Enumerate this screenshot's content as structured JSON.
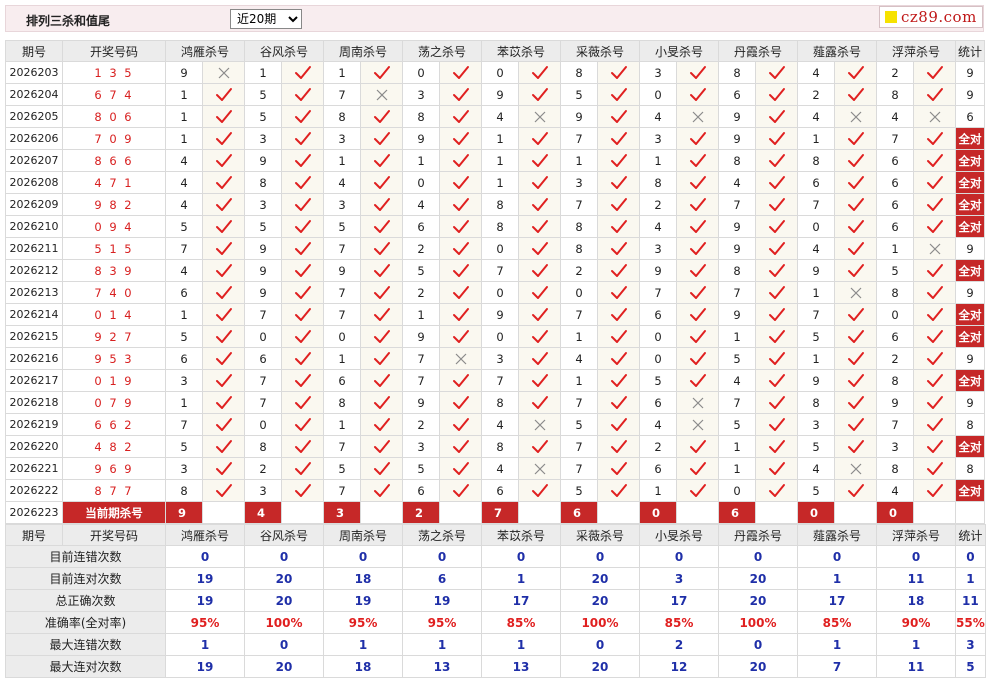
{
  "header": {
    "title": "排列三杀和值尾",
    "period_select": "近20期",
    "logo_text": "cz89.com"
  },
  "columns": {
    "period": "期号",
    "numbers": "开奖号码",
    "killers": [
      "鸿雁杀号",
      "谷风杀号",
      "周南杀号",
      "荡之杀号",
      "苯苡杀号",
      "采薇杀号",
      "小旻杀号",
      "丹霞杀号",
      "薤露杀号",
      "浮萍杀号"
    ],
    "total": "统计"
  },
  "full_label": "全对",
  "rows": [
    {
      "period": "2026203",
      "numbers": "1 3 5",
      "kills": [
        9,
        1,
        1,
        0,
        0,
        8,
        3,
        8,
        4,
        2
      ],
      "marks": [
        "x",
        "v",
        "v",
        "v",
        "v",
        "v",
        "v",
        "v",
        "v",
        "v"
      ],
      "total": "9"
    },
    {
      "period": "2026204",
      "numbers": "6 7 4",
      "kills": [
        1,
        5,
        7,
        3,
        9,
        5,
        0,
        6,
        2,
        8
      ],
      "marks": [
        "v",
        "v",
        "x",
        "v",
        "v",
        "v",
        "v",
        "v",
        "v",
        "v"
      ],
      "total": "9"
    },
    {
      "period": "2026205",
      "numbers": "8 0 6",
      "kills": [
        1,
        5,
        8,
        8,
        4,
        9,
        4,
        9,
        4,
        4
      ],
      "marks": [
        "v",
        "v",
        "v",
        "v",
        "x",
        "v",
        "x",
        "v",
        "x",
        "x"
      ],
      "total": "6"
    },
    {
      "period": "2026206",
      "numbers": "7 0 9",
      "kills": [
        1,
        3,
        3,
        9,
        1,
        7,
        3,
        9,
        1,
        7
      ],
      "marks": [
        "v",
        "v",
        "v",
        "v",
        "v",
        "v",
        "v",
        "v",
        "v",
        "v"
      ],
      "total": "全对"
    },
    {
      "period": "2026207",
      "numbers": "8 6 6",
      "kills": [
        4,
        9,
        1,
        1,
        1,
        1,
        1,
        8,
        8,
        6
      ],
      "marks": [
        "v",
        "v",
        "v",
        "v",
        "v",
        "v",
        "v",
        "v",
        "v",
        "v"
      ],
      "total": "全对"
    },
    {
      "period": "2026208",
      "numbers": "4 7 1",
      "kills": [
        4,
        8,
        4,
        0,
        1,
        3,
        8,
        4,
        6,
        6
      ],
      "marks": [
        "v",
        "v",
        "v",
        "v",
        "v",
        "v",
        "v",
        "v",
        "v",
        "v"
      ],
      "total": "全对"
    },
    {
      "period": "2026209",
      "numbers": "9 8 2",
      "kills": [
        4,
        3,
        3,
        4,
        8,
        7,
        2,
        7,
        7,
        6
      ],
      "marks": [
        "v",
        "v",
        "v",
        "v",
        "v",
        "v",
        "v",
        "v",
        "v",
        "v"
      ],
      "total": "全对"
    },
    {
      "period": "2026210",
      "numbers": "0 9 4",
      "kills": [
        5,
        5,
        5,
        6,
        8,
        8,
        4,
        9,
        0,
        6
      ],
      "marks": [
        "v",
        "v",
        "v",
        "v",
        "v",
        "v",
        "v",
        "v",
        "v",
        "v"
      ],
      "total": "全对"
    },
    {
      "period": "2026211",
      "numbers": "5 1 5",
      "kills": [
        7,
        9,
        7,
        2,
        0,
        8,
        3,
        9,
        4,
        1
      ],
      "marks": [
        "v",
        "v",
        "v",
        "v",
        "v",
        "v",
        "v",
        "v",
        "v",
        "x"
      ],
      "total": "9"
    },
    {
      "period": "2026212",
      "numbers": "8 3 9",
      "kills": [
        4,
        9,
        9,
        5,
        7,
        2,
        9,
        8,
        9,
        5
      ],
      "marks": [
        "v",
        "v",
        "v",
        "v",
        "v",
        "v",
        "v",
        "v",
        "v",
        "v"
      ],
      "total": "全对"
    },
    {
      "period": "2026213",
      "numbers": "7 4 0",
      "kills": [
        6,
        9,
        7,
        2,
        0,
        0,
        7,
        7,
        1,
        8
      ],
      "marks": [
        "v",
        "v",
        "v",
        "v",
        "v",
        "v",
        "v",
        "v",
        "x",
        "v"
      ],
      "total": "9"
    },
    {
      "period": "2026214",
      "numbers": "0 1 4",
      "kills": [
        1,
        7,
        7,
        1,
        9,
        7,
        6,
        9,
        7,
        0
      ],
      "marks": [
        "v",
        "v",
        "v",
        "v",
        "v",
        "v",
        "v",
        "v",
        "v",
        "v"
      ],
      "total": "全对"
    },
    {
      "period": "2026215",
      "numbers": "9 2 7",
      "kills": [
        5,
        0,
        0,
        9,
        0,
        1,
        0,
        1,
        5,
        6
      ],
      "marks": [
        "v",
        "v",
        "v",
        "v",
        "v",
        "v",
        "v",
        "v",
        "v",
        "v"
      ],
      "total": "全对"
    },
    {
      "period": "2026216",
      "numbers": "9 5 3",
      "kills": [
        6,
        6,
        1,
        7,
        3,
        4,
        0,
        5,
        1,
        2
      ],
      "marks": [
        "v",
        "v",
        "v",
        "x",
        "v",
        "v",
        "v",
        "v",
        "v",
        "v"
      ],
      "total": "9"
    },
    {
      "period": "2026217",
      "numbers": "0 1 9",
      "kills": [
        3,
        7,
        6,
        7,
        7,
        1,
        5,
        4,
        9,
        8
      ],
      "marks": [
        "v",
        "v",
        "v",
        "v",
        "v",
        "v",
        "v",
        "v",
        "v",
        "v"
      ],
      "total": "全对"
    },
    {
      "period": "2026218",
      "numbers": "0 7 9",
      "kills": [
        1,
        7,
        8,
        9,
        8,
        7,
        6,
        7,
        8,
        9
      ],
      "marks": [
        "v",
        "v",
        "v",
        "v",
        "v",
        "v",
        "x",
        "v",
        "v",
        "v"
      ],
      "total": "9"
    },
    {
      "period": "2026219",
      "numbers": "6 6 2",
      "kills": [
        7,
        0,
        1,
        2,
        4,
        5,
        4,
        5,
        3,
        7
      ],
      "marks": [
        "v",
        "v",
        "v",
        "v",
        "x",
        "v",
        "x",
        "v",
        "v",
        "v"
      ],
      "total": "8"
    },
    {
      "period": "2026220",
      "numbers": "4 8 2",
      "kills": [
        5,
        8,
        7,
        3,
        8,
        7,
        2,
        1,
        5,
        3
      ],
      "marks": [
        "v",
        "v",
        "v",
        "v",
        "v",
        "v",
        "v",
        "v",
        "v",
        "v"
      ],
      "total": "全对"
    },
    {
      "period": "2026221",
      "numbers": "9 6 9",
      "kills": [
        3,
        2,
        5,
        5,
        4,
        7,
        6,
        1,
        4,
        8
      ],
      "marks": [
        "v",
        "v",
        "v",
        "v",
        "x",
        "v",
        "v",
        "v",
        "x",
        "v"
      ],
      "total": "8"
    },
    {
      "period": "2026222",
      "numbers": "8 7 7",
      "kills": [
        8,
        3,
        7,
        6,
        6,
        5,
        1,
        0,
        5,
        4
      ],
      "marks": [
        "v",
        "v",
        "v",
        "v",
        "v",
        "v",
        "v",
        "v",
        "v",
        "v"
      ],
      "total": "全对"
    }
  ],
  "current": {
    "period": "2026223",
    "label": "当前期杀号",
    "kills": [
      9,
      4,
      3,
      2,
      7,
      6,
      0,
      6,
      0,
      0
    ]
  },
  "stats": {
    "header_period": "期号",
    "header_numbers": "开奖号码",
    "rows": [
      {
        "label": "目前连错次数",
        "values": [
          "0",
          "0",
          "0",
          "0",
          "0",
          "0",
          "0",
          "0",
          "0",
          "0"
        ],
        "total": "0"
      },
      {
        "label": "目前连对次数",
        "values": [
          "19",
          "20",
          "18",
          "6",
          "1",
          "20",
          "3",
          "20",
          "1",
          "11"
        ],
        "total": "1"
      },
      {
        "label": "总正确次数",
        "values": [
          "19",
          "20",
          "19",
          "19",
          "17",
          "20",
          "17",
          "20",
          "17",
          "18"
        ],
        "total": "11"
      },
      {
        "label": "准确率(全对率)",
        "values": [
          "95%",
          "100%",
          "95%",
          "95%",
          "85%",
          "100%",
          "85%",
          "100%",
          "85%",
          "90%"
        ],
        "total": "55%",
        "red": true
      },
      {
        "label": "最大连错次数",
        "values": [
          "1",
          "0",
          "1",
          "1",
          "1",
          "0",
          "2",
          "0",
          "1",
          "1"
        ],
        "total": "3"
      },
      {
        "label": "最大连对次数",
        "values": [
          "19",
          "20",
          "18",
          "13",
          "13",
          "20",
          "12",
          "20",
          "7",
          "11"
        ],
        "total": "5"
      }
    ]
  },
  "colors": {
    "check": "#e02020",
    "cross": "#8a8a8a",
    "accent": "#c62828",
    "stat_blue": "#1f2fa8"
  }
}
